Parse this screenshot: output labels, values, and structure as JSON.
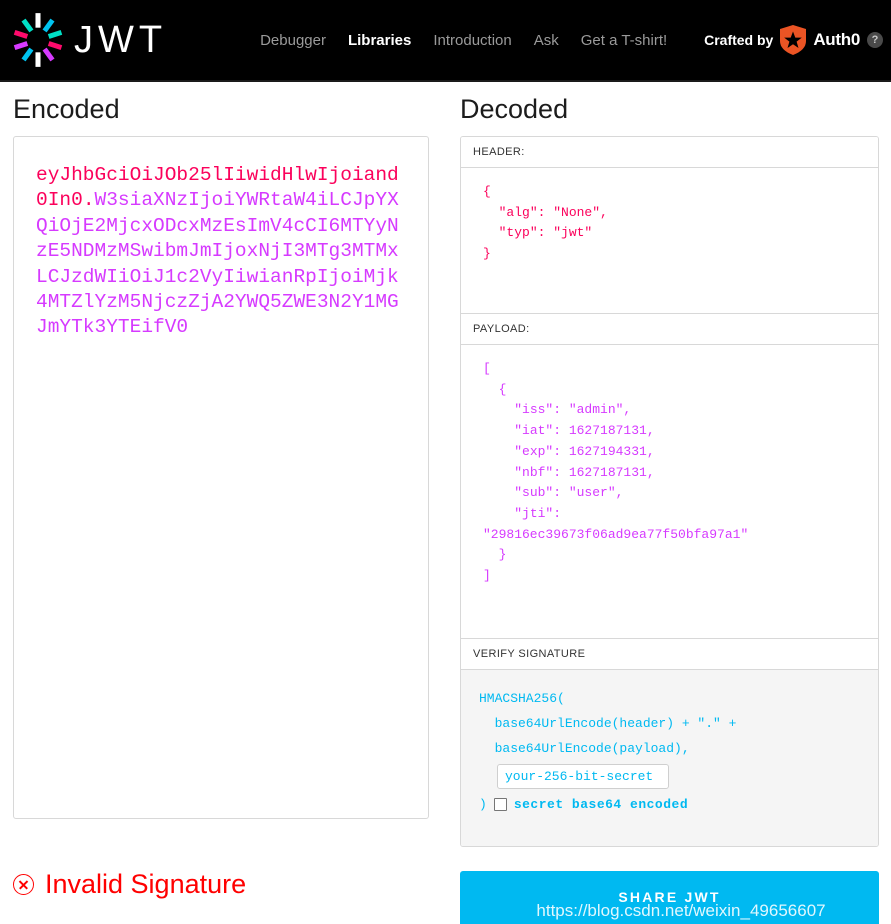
{
  "header": {
    "logo_text": "JWT",
    "logo_icon": "jwt-pinwheel-icon",
    "nav": [
      {
        "label": "Debugger",
        "active": false
      },
      {
        "label": "Libraries",
        "active": true
      },
      {
        "label": "Introduction",
        "active": false
      },
      {
        "label": "Ask",
        "active": false
      },
      {
        "label": "Get a T-shirt!",
        "active": false
      }
    ],
    "crafted_by_label": "Crafted by",
    "auth0_label": "Auth0",
    "auth0_icon": "auth0-shield-icon",
    "help_icon": "help-question-icon",
    "help_glyph": "?"
  },
  "encoded": {
    "title": "Encoded",
    "token_header": "eyJhbGciOiJOb25lIiwidHlwIjoiand0In0",
    "token_dot": ".",
    "token_payload": "W3siaXNzIjoiYWRtaW4iLCJpYXQiOjE2MjcxODcxMzEsImV4cCI6MTYyNzE5NDMzMSwibmJmIjoxNjI3MTg3MTMxLCJzdWIiOiJ1c2VyIiwianRpIjoiMjk4MTZlYzM5NjczZjA2YWQ5ZWE3N2Y1MGJmYTk3YTEifV0"
  },
  "decoded": {
    "title": "Decoded",
    "header_label": "HEADER:",
    "header_json": "{\n  \"alg\": \"None\",\n  \"typ\": \"jwt\"\n}",
    "payload_label": "PAYLOAD:",
    "payload_json": "[\n  {\n    \"iss\": \"admin\",\n    \"iat\": 1627187131,\n    \"exp\": 1627194331,\n    \"nbf\": 1627187131,\n    \"sub\": \"user\",\n    \"jti\":\n\"29816ec39673f06ad9ea77f50bfa97a1\"\n  }\n]",
    "signature_label": "VERIFY SIGNATURE",
    "sig_line1": "HMACSHA256(",
    "sig_line2": "  base64UrlEncode(header) + \".\" +",
    "sig_line3": "  base64UrlEncode(payload),",
    "secret_value": "your-256-bit-secret",
    "secret_placeholder": "your-256-bit-secret",
    "close_paren": ")",
    "base64_checkbox_label": "secret base64 encoded",
    "base64_checked": false
  },
  "footer": {
    "status_text": "Invalid Signature",
    "status_icon": "error-circle-x-icon",
    "share_button_label": "SHARE JWT",
    "watermark": "https://blog.csdn.net/weixin_49656607"
  },
  "colors": {
    "header_red": "#fb015b",
    "payload_magenta": "#d63aff",
    "signature_blue": "#00b9f1",
    "error_red": "#ff0000",
    "auth0_orange": "#eb5424",
    "topbar_black": "#000000"
  }
}
